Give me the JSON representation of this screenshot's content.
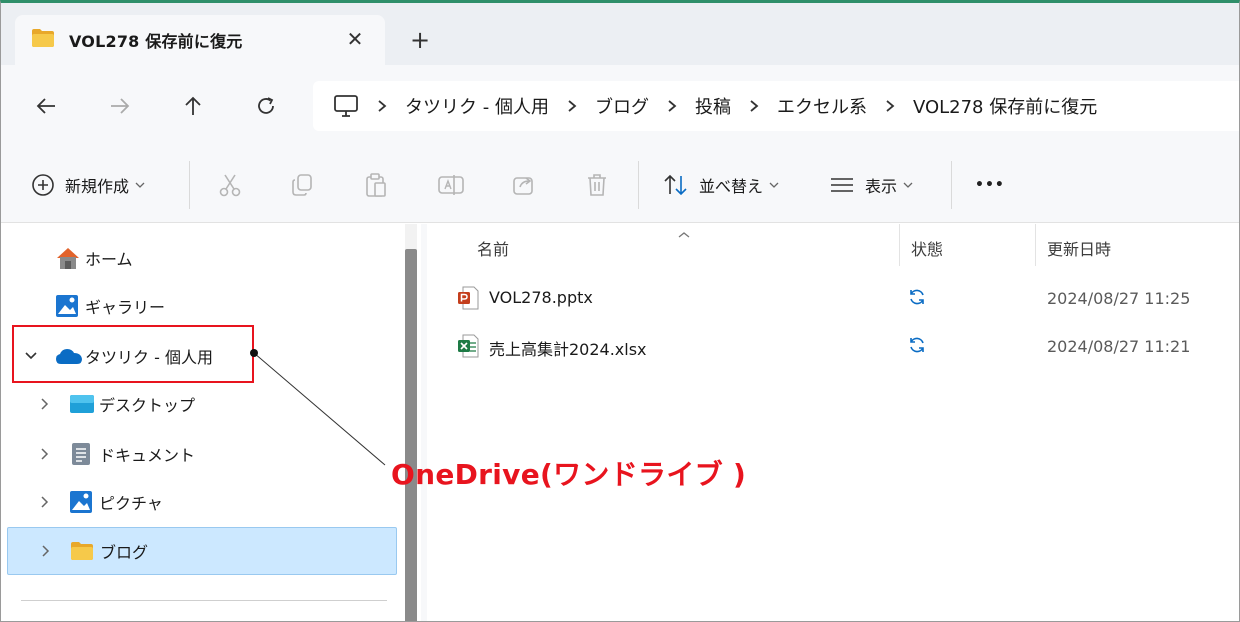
{
  "window": {
    "tab_title": "VOL278 保存前に復元",
    "tab_close": "✕",
    "new_tab": "+"
  },
  "breadcrumbs": [
    "タツリク - 個人用",
    "ブログ",
    "投稿",
    "エクセル系",
    "VOL278 保存前に復元"
  ],
  "toolbar": {
    "new_label": "新規作成",
    "sort_label": "並べ替え",
    "view_label": "表示",
    "more_label": "•••"
  },
  "nav": {
    "items": [
      {
        "label": "ホーム",
        "icon": "home-icon"
      },
      {
        "label": "ギャラリー",
        "icon": "gallery-icon"
      },
      {
        "label": "タツリク - 個人用",
        "icon": "onedrive-cloud-icon"
      },
      {
        "label": "デスクトップ",
        "icon": "desktop-icon"
      },
      {
        "label": "ドキュメント",
        "icon": "documents-icon"
      },
      {
        "label": "ピクチャ",
        "icon": "pictures-icon"
      },
      {
        "label": "ブログ",
        "icon": "folder-icon"
      }
    ]
  },
  "columns": {
    "name": "名前",
    "status": "状態",
    "modified": "更新日時"
  },
  "files": [
    {
      "name": "VOL278.pptx",
      "type": "powerpoint",
      "date": "2024/08/27 11:25"
    },
    {
      "name": "売上高集計2024.xlsx",
      "type": "excel",
      "date": "2024/08/27 11:21"
    }
  ],
  "annotation": {
    "text": "OneDrive(ワンドライブ )",
    "color": "#e8141e"
  },
  "colors": {
    "selection": "#cce8ff",
    "accent_blue": "#0a6cc4",
    "annotation_red": "#e8141e"
  }
}
